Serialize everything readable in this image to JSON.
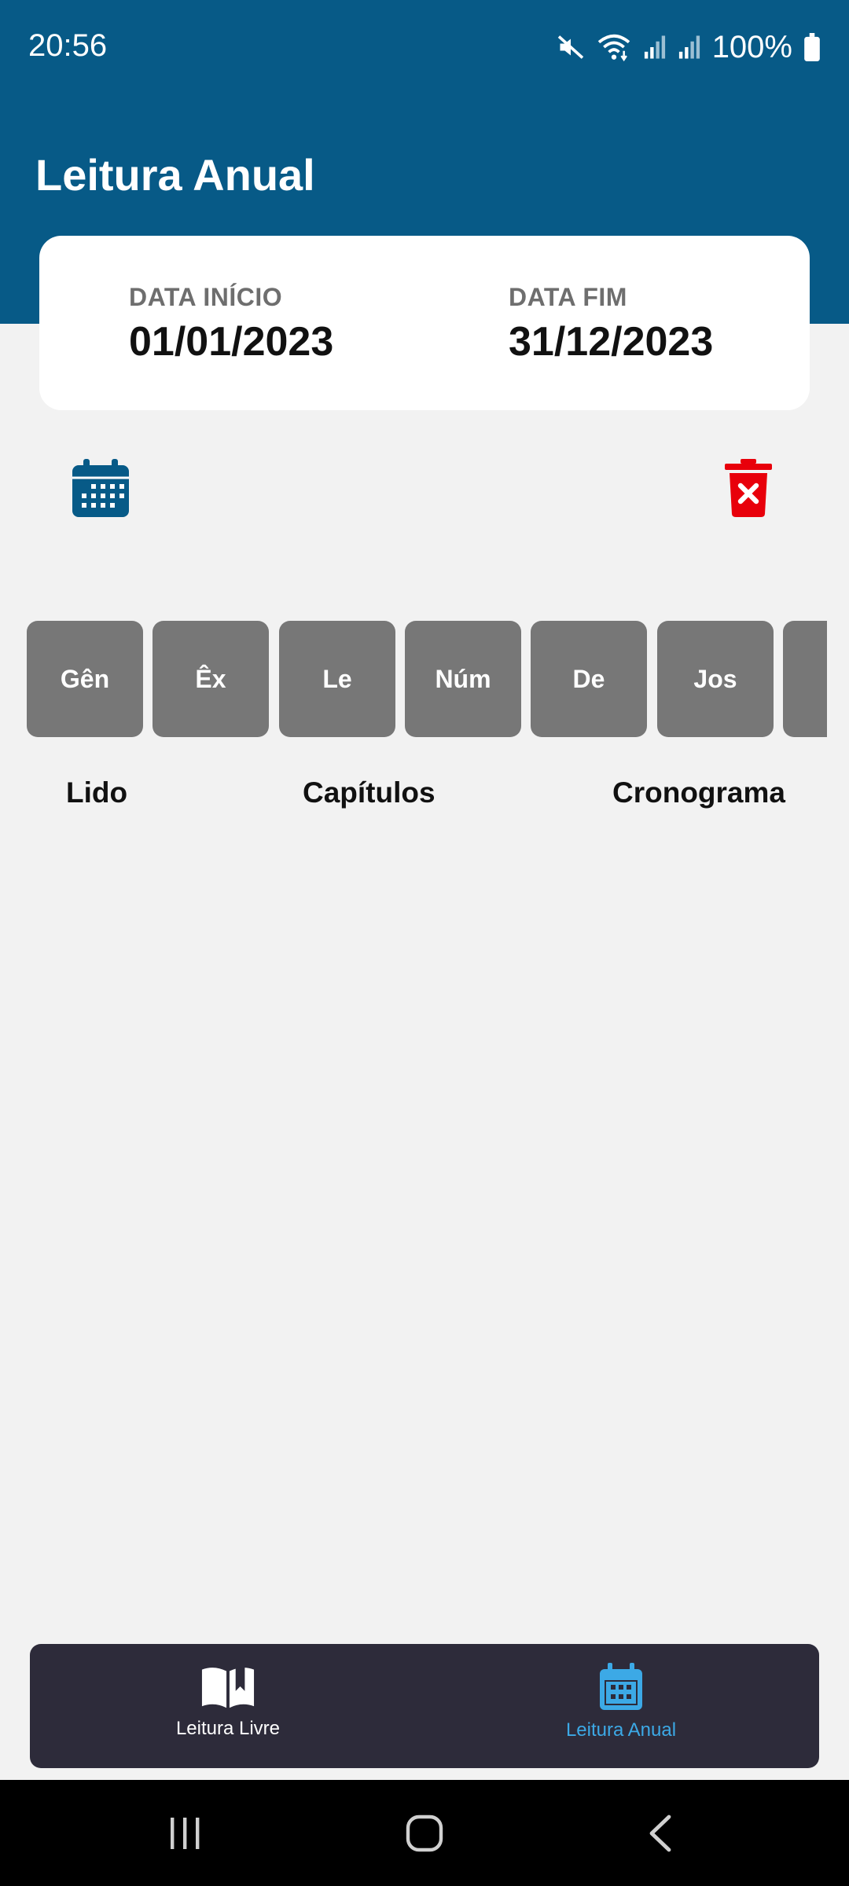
{
  "status_bar": {
    "time": "20:56",
    "battery": "100%",
    "icons": [
      "mute-icon",
      "wifi-icon",
      "signal-icon",
      "signal-icon",
      "battery-icon"
    ]
  },
  "header": {
    "title": "Leitura Anual"
  },
  "date_card": {
    "start_label": "DATA INÍCIO",
    "start_value": "01/01/2023",
    "end_label": "DATA FIM",
    "end_value": "31/12/2023"
  },
  "actions": {
    "calendar_icon": "calendar-icon",
    "delete_icon": "trash-delete-icon"
  },
  "books": [
    "Gên",
    "Êx",
    "Le",
    "Núm",
    "De",
    "Jos",
    ""
  ],
  "columns": {
    "read": "Lido",
    "chapters": "Capítulos",
    "schedule": "Cronograma"
  },
  "bottom_nav": {
    "items": [
      {
        "label": "Leitura Livre",
        "icon": "open-book-icon",
        "active": false
      },
      {
        "label": "Leitura Anual",
        "icon": "calendar-icon",
        "active": true
      }
    ]
  },
  "colors": {
    "header": "#075a87",
    "accent": "#3ca9e6",
    "delete": "#e8000b",
    "nav_bg": "#2d2b3a",
    "chip": "#777777"
  }
}
